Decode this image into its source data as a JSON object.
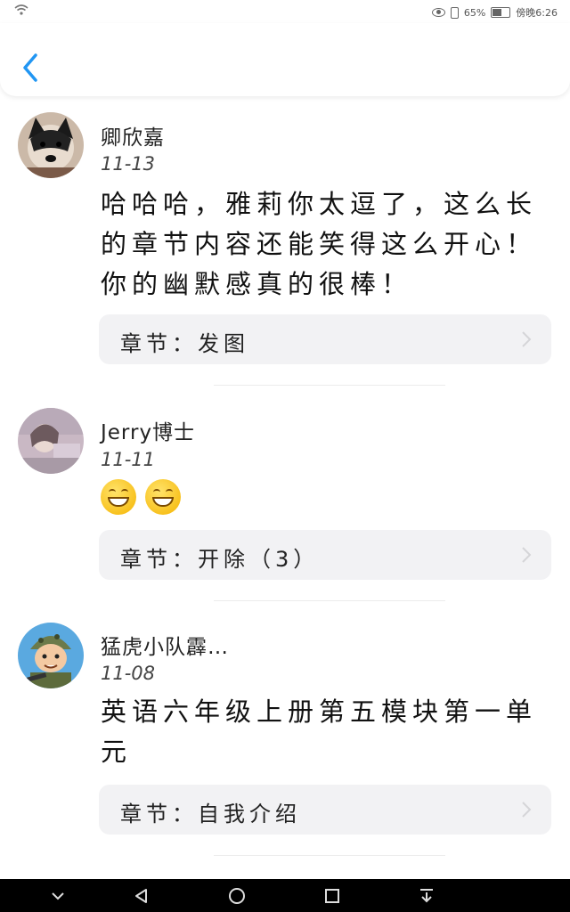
{
  "status_bar": {
    "wifi_icon": "wifi-icon",
    "battery_percent": "65%",
    "battery_level": 0.65,
    "time": "傍晚6:26"
  },
  "header": {
    "back_icon": "chevron-left-icon",
    "accent": "#2196f3"
  },
  "comments": [
    {
      "username": "卿欣嘉",
      "date": "11-13",
      "text": "哈哈哈，雅莉你太逗了，这么长的章节内容还能笑得这么开心！你的幽默感真的很棒！",
      "chapter": "章节：发图"
    },
    {
      "username": "Jerry博士",
      "date": "11-11",
      "emojis": [
        "grinning-face-emoji",
        "grinning-face-emoji"
      ],
      "chapter": "章节：开除（3）"
    },
    {
      "username": "猛虎小队霹…",
      "date": "11-08",
      "text": "英语六年级上册第五模块第一单元",
      "chapter": "章节：自我介绍"
    }
  ],
  "nav_bar": {
    "items": [
      "chevron-down-icon",
      "back-triangle-icon",
      "home-circle-icon",
      "recents-square-icon",
      "notification-pull-icon"
    ]
  }
}
